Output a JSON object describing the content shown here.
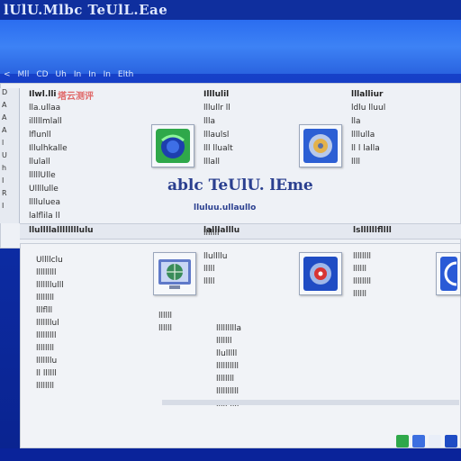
{
  "window": {
    "title": "lUlU.Mlbc TeUlL.Eae"
  },
  "toolbar": {
    "items": [
      "<",
      "Mll",
      "CD",
      "Uh",
      "In",
      "In",
      "In",
      "Elth"
    ]
  },
  "brand": {
    "label": "塔云测评"
  },
  "left_tree": {
    "items": [
      "D",
      "A",
      "A",
      "A",
      "l",
      "U",
      "h",
      "I",
      "R",
      "I"
    ]
  },
  "top_left_list": {
    "header": "Ilwl.lli",
    "rows": [
      "lla.ullaa",
      "illlllmlall",
      "lflunll",
      "Illulhkalle",
      "llulall",
      "lllllUlle",
      "Ullllulle",
      "lllluluea",
      "lalflila ll"
    ]
  },
  "top_mid_list": {
    "header": "Illlulil",
    "rows": [
      "lllullr ll",
      "llla",
      "lllaulsl",
      "lll llualt",
      "lllall"
    ]
  },
  "top_right_list": {
    "header": "lllalliur",
    "rows": [
      "ldlu lluul",
      "lla",
      "llllulla",
      "ll l lalla",
      "llll"
    ]
  },
  "center": {
    "title": "ablc TeUlU. lEme",
    "subtitle": "lluluu.ullaullo"
  },
  "section_bar": {
    "labels": [
      "llullllallllllllulu",
      "lalllalllu",
      "lsllllllfllll"
    ]
  },
  "bottom_left_list": {
    "rows": [
      "Ullllclu",
      "lllllllll",
      "lllllllulll",
      "llllllll",
      "lllflll",
      "lllllllul",
      "lllllllll",
      "llllllll",
      "lllllllu",
      "ll llllll",
      "llllllll"
    ]
  },
  "bottom_mid_list": {
    "rows": [
      "lllllll",
      "llullllu",
      "lllll",
      "lllll",
      "llllll",
      "llllll"
    ]
  },
  "bottom_mid2_list": {
    "rows": [
      "llllllllla",
      "lllllll",
      "llulllll",
      "llllllllll",
      "llllllll",
      "llllllllll",
      "lllll llll"
    ]
  },
  "bottom_right_list": {
    "rows": [
      "llllllll",
      "llllll",
      "llllllll",
      "llllll"
    ]
  },
  "colors": {
    "desktop": "#0a238f",
    "accent": "#2a63e0",
    "window": "#eef1f6"
  },
  "icons": [
    "green-globe-icon",
    "blue-disc-icon",
    "computer-globe-icon",
    "red-target-icon",
    "blue-arc-icon"
  ]
}
